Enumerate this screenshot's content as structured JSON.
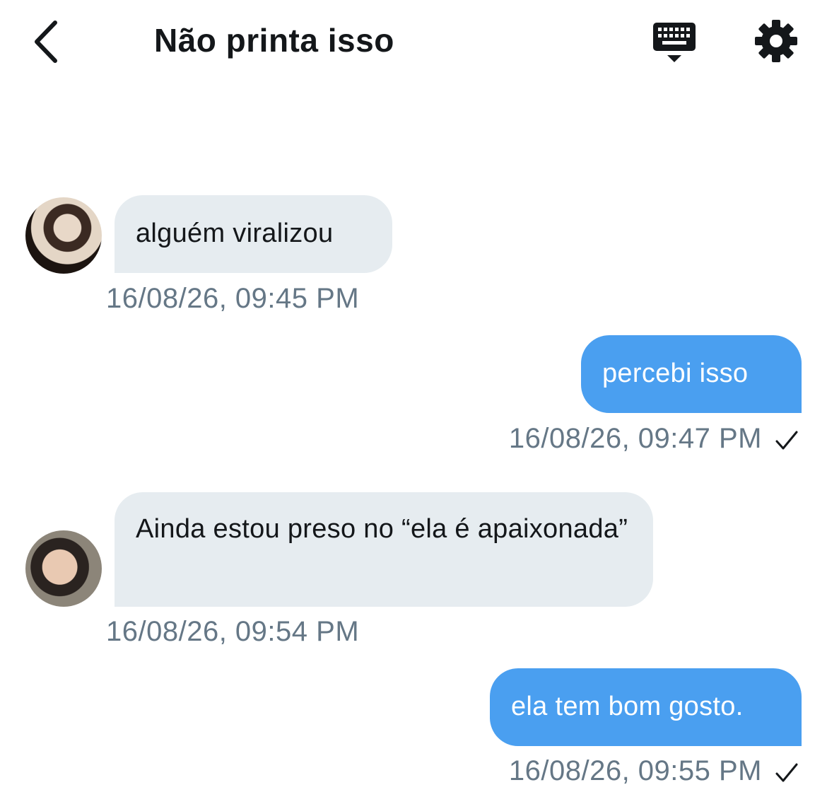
{
  "header": {
    "title": "Não printa isso",
    "back_icon": "chevron-left-icon",
    "keyboard_icon": "keyboard-icon",
    "settings_icon": "gear-icon"
  },
  "messages": [
    {
      "direction": "incoming",
      "text": "alguém viralizou",
      "timestamp": "16/08/26, 09:45 PM"
    },
    {
      "direction": "outgoing",
      "text": "percebi isso",
      "timestamp": "16/08/26, 09:47 PM",
      "status_icon": "checkmark-icon"
    },
    {
      "direction": "incoming",
      "text": "Ainda estou preso no “ela é apaixonada”",
      "timestamp": "16/08/26, 09:54 PM"
    },
    {
      "direction": "outgoing",
      "text": "ela tem bom gosto.",
      "timestamp": "16/08/26, 09:55 PM",
      "status_icon": "checkmark-icon"
    }
  ],
  "colors": {
    "outgoing_bubble": "#4a9ff0",
    "incoming_bubble": "#e6ecf0",
    "timestamp": "#657786"
  }
}
